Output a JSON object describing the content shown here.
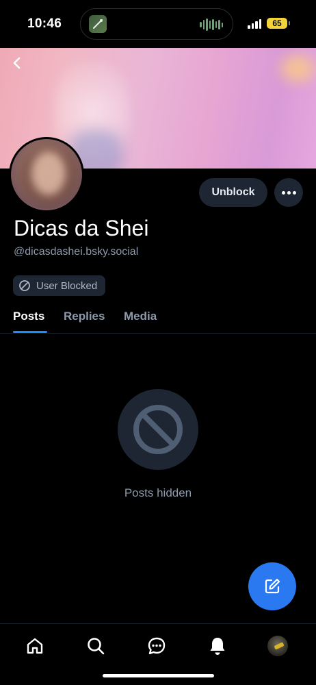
{
  "status_bar": {
    "time": "10:46",
    "battery": "65"
  },
  "profile": {
    "display_name": "Dicas da Shei",
    "handle": "@dicasdashei.bsky.social",
    "blocked_badge": "User Blocked"
  },
  "actions": {
    "unblock_label": "Unblock",
    "more_icon": "ellipsis-icon"
  },
  "tabs": [
    {
      "label": "Posts",
      "active": true
    },
    {
      "label": "Replies",
      "active": false
    },
    {
      "label": "Media",
      "active": false
    }
  ],
  "empty_state": {
    "message": "Posts hidden",
    "icon": "block-icon"
  },
  "bottom_nav": {
    "items": [
      "home-icon",
      "search-icon",
      "chat-icon",
      "notifications-icon",
      "profile-avatar"
    ]
  },
  "colors": {
    "accent": "#1d8cf8",
    "fab": "#2a79f0",
    "surface": "#1e2633",
    "muted_text": "#8d99aa"
  }
}
